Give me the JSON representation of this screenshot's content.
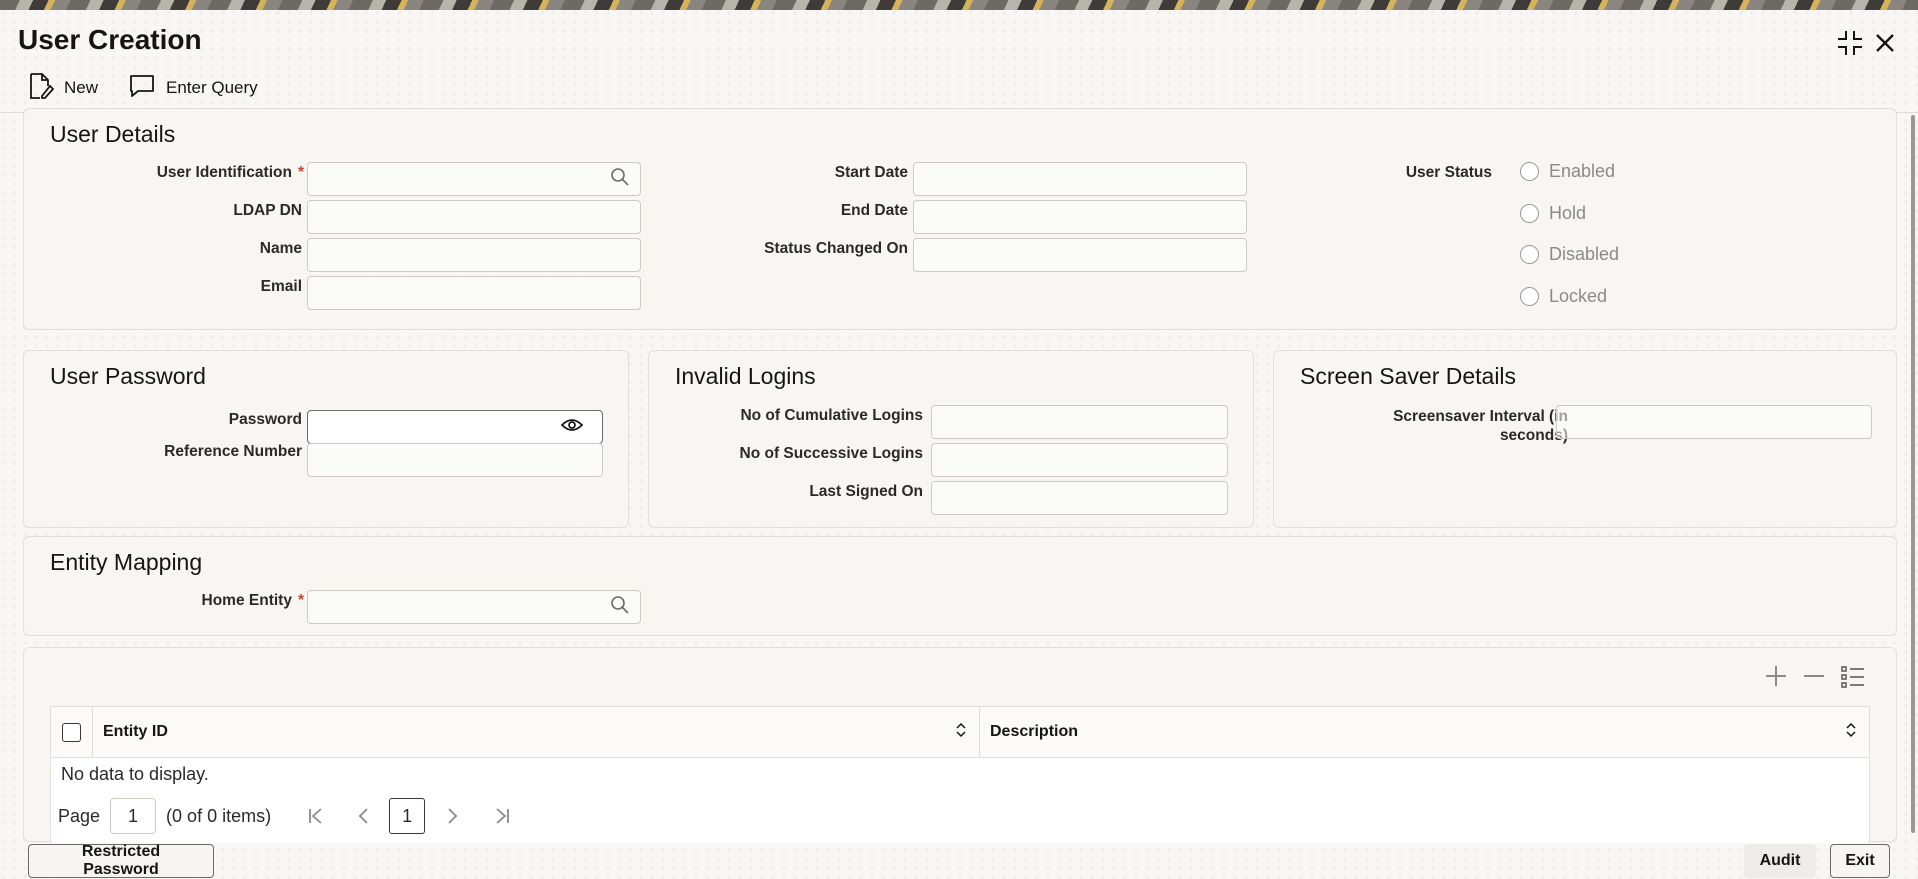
{
  "window": {
    "title": "User Creation"
  },
  "toolbar": {
    "new_label": "New",
    "enter_query_label": "Enter Query"
  },
  "user_details": {
    "title": "User Details",
    "user_identification_label": "User Identification",
    "ldap_dn_label": "LDAP DN",
    "name_label": "Name",
    "email_label": "Email",
    "start_date_label": "Start Date",
    "end_date_label": "End Date",
    "status_changed_on_label": "Status Changed On",
    "user_status_label": "User Status",
    "status_options": [
      "Enabled",
      "Hold",
      "Disabled",
      "Locked"
    ],
    "user_identification_value": "",
    "ldap_dn_value": "",
    "name_value": "",
    "email_value": "",
    "start_date_value": "",
    "end_date_value": "",
    "status_changed_on_value": ""
  },
  "user_password": {
    "title": "User Password",
    "password_label": "Password",
    "reference_number_label": "Reference Number",
    "password_value": "",
    "reference_number_value": ""
  },
  "invalid_logins": {
    "title": "Invalid Logins",
    "cumulative_label": "No of Cumulative Logins",
    "successive_label": "No of Successive Logins",
    "last_signed_on_label": "Last Signed On",
    "cumulative_value": "",
    "successive_value": "",
    "last_signed_on_value": ""
  },
  "screen_saver": {
    "title": "Screen Saver Details",
    "interval_label_line1": "Screensaver Interval (in",
    "interval_label_line2": "seconds)",
    "interval_value": ""
  },
  "entity_mapping": {
    "title": "Entity Mapping",
    "home_entity_label": "Home Entity",
    "home_entity_value": ""
  },
  "grid": {
    "columns": [
      "Entity ID",
      "Description"
    ],
    "empty_text": "No data to display.",
    "page_label": "Page",
    "page_value": "1",
    "items_text": "(0 of 0 items)",
    "current_page": "1"
  },
  "footer": {
    "restricted_password_label": "Restricted Password",
    "audit_label": "Audit",
    "exit_label": "Exit"
  },
  "icons": [
    "maximize-icon",
    "close-icon",
    "new-document-icon",
    "enter-query-icon",
    "search-icon",
    "eye-icon",
    "add-icon",
    "remove-icon",
    "column-list-icon",
    "sort-icon",
    "first-page-icon",
    "prev-page-icon",
    "next-page-icon",
    "last-page-icon"
  ]
}
